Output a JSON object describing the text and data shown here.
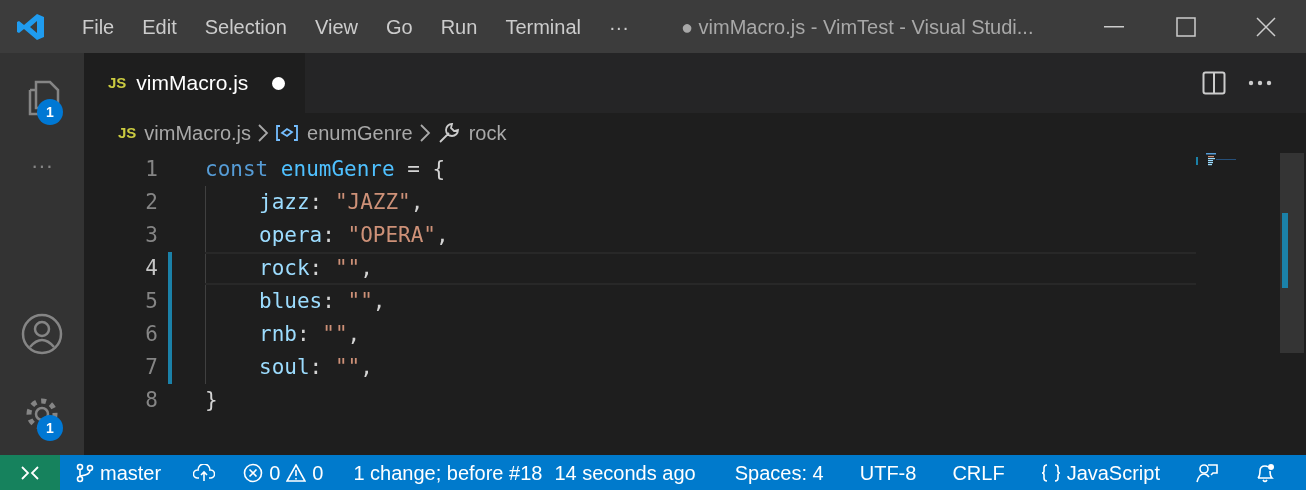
{
  "menu": [
    "File",
    "Edit",
    "Selection",
    "View",
    "Go",
    "Run",
    "Terminal"
  ],
  "menu_overflow": "···",
  "window": {
    "title": "● vimMacro.js - VimTest - Visual Studi..."
  },
  "activity_bar": {
    "explorer_badge": "1",
    "more": "···",
    "settings_badge": "1"
  },
  "tabs": [
    {
      "icon": "JS",
      "label": "vimMacro.js",
      "dirty": true,
      "selected": true
    }
  ],
  "breadcrumb": [
    {
      "kind": "file",
      "icon": "JS",
      "label": "vimMacro.js"
    },
    {
      "kind": "variable",
      "label": "enumGenre"
    },
    {
      "kind": "property",
      "label": "rock"
    }
  ],
  "editor": {
    "lines": [
      {
        "number": "1",
        "modified": false,
        "current": false,
        "indented": false,
        "tokens": [
          {
            "kind": "keyword",
            "text": "const "
          },
          {
            "kind": "variable",
            "text": "enumGenre"
          },
          {
            "kind": "plain",
            "text": " = {"
          }
        ]
      },
      {
        "number": "2",
        "modified": false,
        "current": false,
        "indented": true,
        "tokens": [
          {
            "kind": "property",
            "text": "jazz"
          },
          {
            "kind": "plain",
            "text": ": "
          },
          {
            "kind": "string",
            "text": "\"JAZZ\""
          },
          {
            "kind": "plain",
            "text": ","
          }
        ]
      },
      {
        "number": "3",
        "modified": false,
        "current": false,
        "indented": true,
        "tokens": [
          {
            "kind": "property",
            "text": "opera"
          },
          {
            "kind": "plain",
            "text": ": "
          },
          {
            "kind": "string",
            "text": "\"OPERA\""
          },
          {
            "kind": "plain",
            "text": ","
          }
        ]
      },
      {
        "number": "4",
        "modified": true,
        "current": true,
        "indented": true,
        "tokens": [
          {
            "kind": "property",
            "text": "rock"
          },
          {
            "kind": "plain",
            "text": ": "
          },
          {
            "kind": "string",
            "text": "\"\""
          },
          {
            "kind": "plain",
            "text": ","
          }
        ]
      },
      {
        "number": "5",
        "modified": true,
        "current": false,
        "indented": true,
        "tokens": [
          {
            "kind": "property",
            "text": "blues"
          },
          {
            "kind": "plain",
            "text": ": "
          },
          {
            "kind": "string",
            "text": "\"\""
          },
          {
            "kind": "plain",
            "text": ","
          }
        ]
      },
      {
        "number": "6",
        "modified": true,
        "current": false,
        "indented": true,
        "tokens": [
          {
            "kind": "property",
            "text": "rnb"
          },
          {
            "kind": "plain",
            "text": ": "
          },
          {
            "kind": "string",
            "text": "\"\""
          },
          {
            "kind": "plain",
            "text": ","
          }
        ]
      },
      {
        "number": "7",
        "modified": true,
        "current": false,
        "indented": true,
        "tokens": [
          {
            "kind": "property",
            "text": "soul"
          },
          {
            "kind": "plain",
            "text": ": "
          },
          {
            "kind": "string",
            "text": "\"\""
          },
          {
            "kind": "plain",
            "text": ","
          }
        ]
      },
      {
        "number": "8",
        "modified": false,
        "current": false,
        "indented": false,
        "tokens": [
          {
            "kind": "plain",
            "text": "}"
          }
        ]
      }
    ]
  },
  "status_bar": {
    "left": [
      {
        "kind": "branch",
        "text": "master"
      },
      {
        "kind": "sync"
      },
      {
        "kind": "errors",
        "text": "0"
      },
      {
        "kind": "warnings",
        "text": "0"
      },
      {
        "kind": "text",
        "text": "1 change; before #18"
      },
      {
        "kind": "text",
        "text": "14 seconds ago"
      }
    ],
    "right": [
      {
        "kind": "text",
        "text": "Spaces: 4"
      },
      {
        "kind": "text",
        "text": "UTF-8"
      },
      {
        "kind": "text",
        "text": "CRLF"
      },
      {
        "kind": "language",
        "text": "JavaScript"
      },
      {
        "kind": "feedback"
      },
      {
        "kind": "bell"
      }
    ]
  }
}
